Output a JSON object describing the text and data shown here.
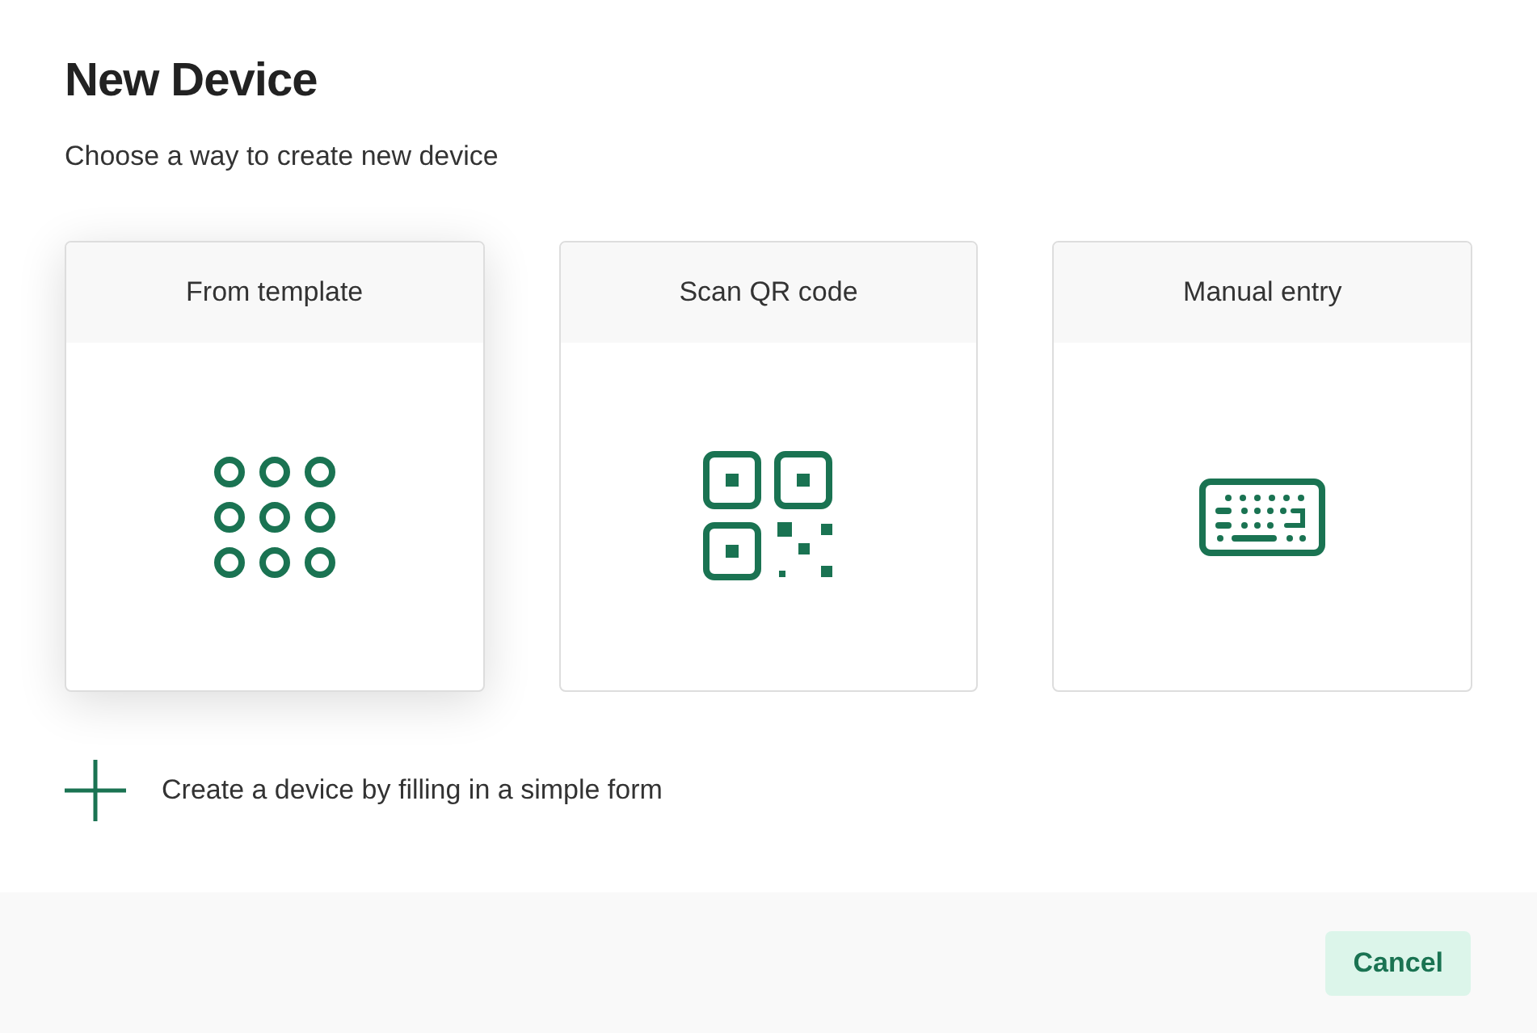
{
  "title": "New Device",
  "subtitle": "Choose a way to create new device",
  "options": [
    {
      "label": "From template",
      "kind": "template",
      "selected": true
    },
    {
      "label": "Scan QR code",
      "kind": "qr",
      "selected": false
    },
    {
      "label": "Manual entry",
      "kind": "keyboard",
      "selected": false
    }
  ],
  "create_link": "Create a device by filling in a simple form",
  "buttons": {
    "cancel": "Cancel"
  }
}
